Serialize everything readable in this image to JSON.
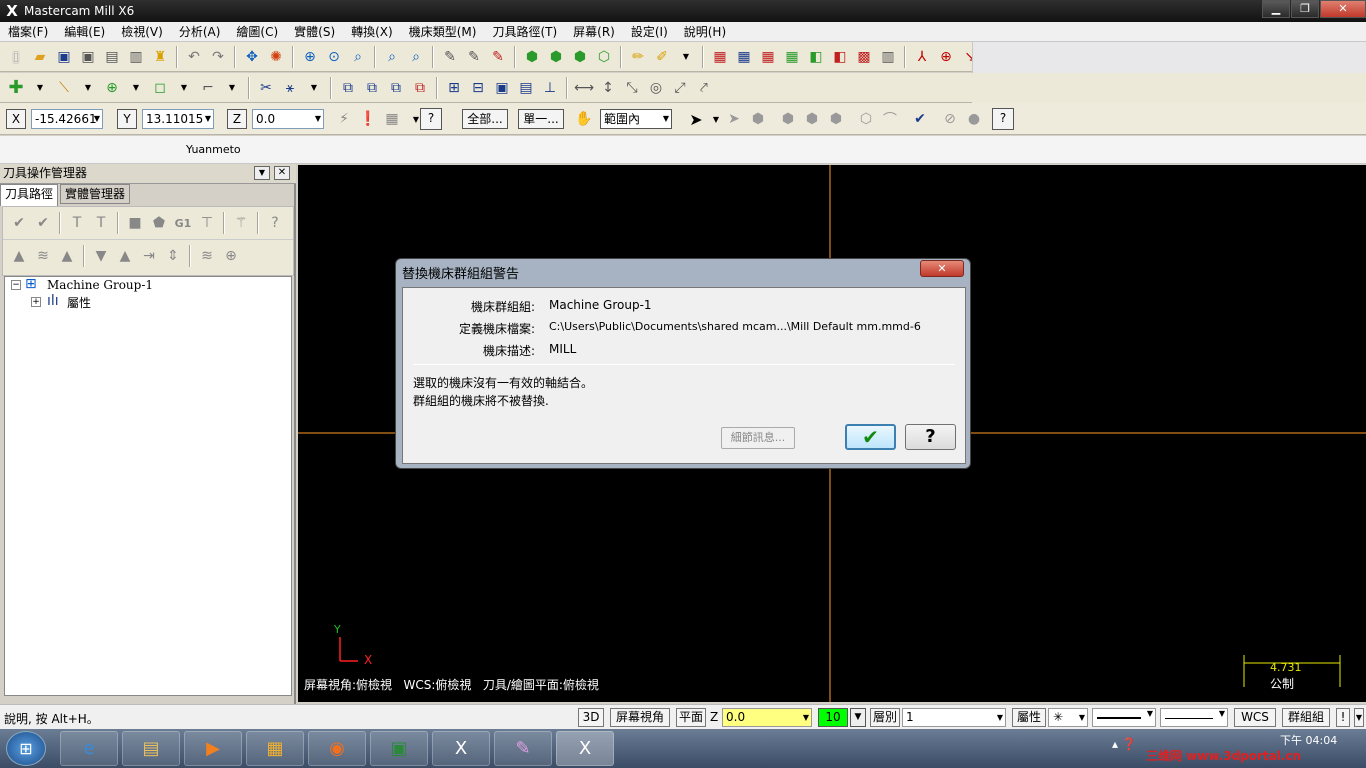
{
  "window": {
    "title": "Mastercam Mill X6",
    "min": "▁",
    "max": "❐",
    "close": "✕"
  },
  "menu": [
    "檔案(F)",
    "編輯(E)",
    "檢視(V)",
    "分析(A)",
    "繪圖(C)",
    "實體(S)",
    "轉換(X)",
    "機床類型(M)",
    "刀具路徑(T)",
    "屏幕(R)",
    "設定(I)",
    "說明(H)"
  ],
  "autocursor": {
    "x_label": "X",
    "x_value": "-15.42661",
    "y_label": "Y",
    "y_value": "13.11015",
    "z_label": "Z",
    "z_value": "0.0",
    "all_label": "全部...",
    "single_label": "單一...",
    "range_value": "範圍內"
  },
  "caption": "Yuanmeto",
  "panel": {
    "title": "刀具操作管理器",
    "tab_toolpaths": "刀具路徑",
    "tab_solids": "實體管理器",
    "g1": "G1",
    "tree_group": "Machine Group-1",
    "tree_props": "屬性"
  },
  "graphics": {
    "axis_y": "Y",
    "axis_x": "X",
    "status": "屏幕視角:俯檢視   WCS:俯檢視   刀具/繪圖平面:俯檢視",
    "scale_value": "4.731",
    "scale_unit": "公制"
  },
  "dialog": {
    "title": "替換機床群組組警告",
    "group_label": "機床群組組:",
    "group_value": "Machine Group-1",
    "file_label": "定義機床檔案:",
    "file_value": "C:\\Users\\Public\\Documents\\shared mcam...\\Mill Default mm.mmd-6",
    "desc_label": "機床描述:",
    "desc_value": "MILL",
    "message1": "選取的機床沒有一有效的軸結合。",
    "message2": "群組組的機床將不被替換.",
    "details_label": "細節訊息...",
    "ok_glyph": "✔",
    "help_glyph": "?"
  },
  "statusbar": {
    "help": "說明, 按 Alt+H。",
    "btn_3d": "3D",
    "btn_view": "屏幕視角",
    "btn_plane": "平面",
    "z_label": "Z",
    "z_value": "0.0",
    "color_value": "10",
    "level_label": "層別",
    "level_value": "1",
    "attr_label": "屬性",
    "wcs_label": "WCS",
    "group_label": "群組組",
    "excl": "!"
  },
  "taskbar": {
    "time": "下午 04:04",
    "watermark": "三维网 www.3dportal.cn"
  },
  "colors": {
    "accent": "#0a5cc8",
    "axis": "#ff9a2a",
    "zfield": "#ffff80",
    "colorfield": "#00ff00",
    "scale": "#e8e800"
  }
}
